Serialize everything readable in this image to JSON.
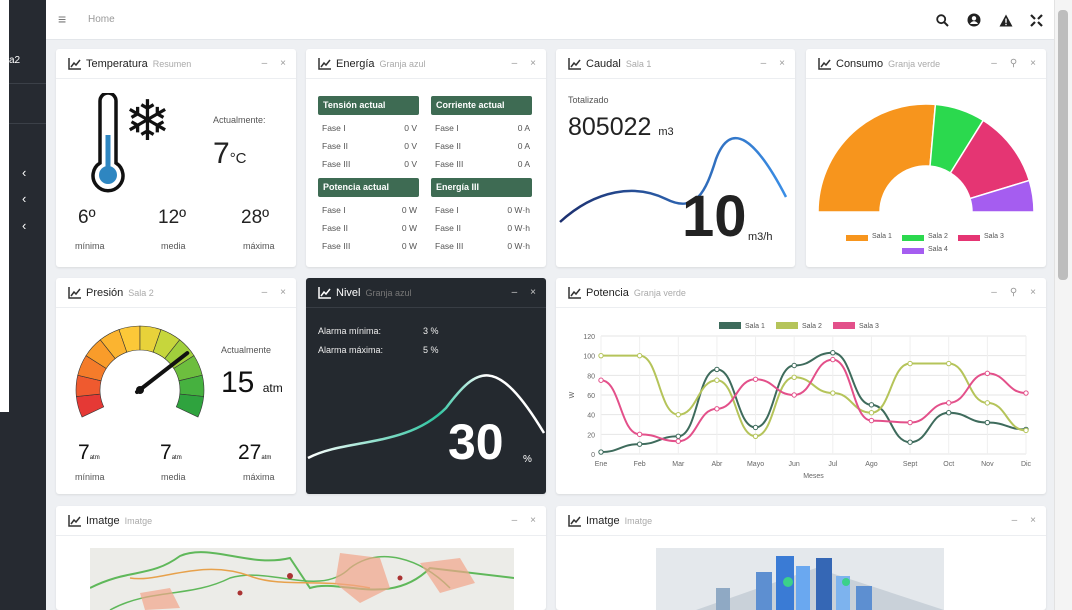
{
  "sidebar": {
    "brand": "a2"
  },
  "topbar": {
    "home": "Home"
  },
  "temperatura": {
    "title": "Temperatura",
    "sub": "Resumen",
    "current_label": "Actualmente:",
    "current": "7",
    "unit": "°C",
    "min": "6º",
    "avg": "12º",
    "max": "28º",
    "min_label": "mínima",
    "avg_label": "media",
    "max_label": "máxima"
  },
  "energia": {
    "title": "Energía",
    "sub": "Granja azul",
    "tension": {
      "header": "Tensión actual",
      "rows": [
        {
          "l": "Fase I",
          "v": "0 V"
        },
        {
          "l": "Fase II",
          "v": "0 V"
        },
        {
          "l": "Fase III",
          "v": "0 V"
        }
      ]
    },
    "corriente": {
      "header": "Corriente actual",
      "rows": [
        {
          "l": "Fase I",
          "v": "0 A"
        },
        {
          "l": "Fase II",
          "v": "0 A"
        },
        {
          "l": "Fase III",
          "v": "0 A"
        }
      ]
    },
    "potencia": {
      "header": "Potencia actual",
      "rows": [
        {
          "l": "Fase I",
          "v": "0 W"
        },
        {
          "l": "Fase II",
          "v": "0 W"
        },
        {
          "l": "Fase III",
          "v": "0 W"
        }
      ]
    },
    "energia3": {
      "header": "Energía III",
      "rows": [
        {
          "l": "Fase I",
          "v": "0 W·h"
        },
        {
          "l": "Fase II",
          "v": "0 W·h"
        },
        {
          "l": "Fase III",
          "v": "0 W·h"
        }
      ]
    }
  },
  "caudal": {
    "title": "Caudal",
    "sub": "Sala 1",
    "total_label": "Totalizado",
    "total": "805022",
    "total_unit": "m3",
    "value": "10",
    "unit": "m3/h"
  },
  "consumo": {
    "title": "Consumo",
    "sub": "Granja verde",
    "legend": [
      {
        "name": "Sala 1",
        "color": "#f7951d"
      },
      {
        "name": "Sala 2",
        "color": "#2bd94e"
      },
      {
        "name": "Sala 3",
        "color": "#e53573"
      },
      {
        "name": "Sala 4",
        "color": "#a55df0"
      }
    ]
  },
  "presion": {
    "title": "Presión",
    "sub": "Sala 2",
    "current_label": "Actualmente",
    "current": "15",
    "unit": "atm",
    "min": "7",
    "avg": "7",
    "max": "27",
    "small_unit": "atm",
    "min_label": "mínima",
    "avg_label": "media",
    "max_label": "máxima"
  },
  "nivel": {
    "title": "Nivel",
    "sub": "Granja azul",
    "alarm_min_label": "Alarma mínima:",
    "alarm_min": "3 %",
    "alarm_max_label": "Alarma máxima:",
    "alarm_max": "5 %",
    "value": "30",
    "unit": "%"
  },
  "potencia": {
    "title": "Potencia",
    "sub": "Granja verde"
  },
  "imatge1": {
    "title": "Imatge",
    "sub": "Imatge"
  },
  "imatge2": {
    "title": "Imatge",
    "sub": "Imatge"
  },
  "chart_data": {
    "type": "line",
    "categories": [
      "Ene",
      "Feb",
      "Mar",
      "Abr",
      "Mayo",
      "Jun",
      "Jul",
      "Ago",
      "Sept",
      "Oct",
      "Nov",
      "Dic"
    ],
    "xlabel": "Meses",
    "ylabel": "W",
    "ylim": [
      0,
      120
    ],
    "yticks": [
      0,
      20,
      40,
      60,
      80,
      100,
      120
    ],
    "series": [
      {
        "name": "Sala 1",
        "color": "#3e6b5c",
        "values": [
          2,
          10,
          18,
          86,
          27,
          90,
          103,
          50,
          12,
          42,
          32,
          25
        ]
      },
      {
        "name": "Sala 2",
        "color": "#b5c45a",
        "values": [
          100,
          100,
          40,
          75,
          18,
          78,
          62,
          42,
          92,
          92,
          52,
          24
        ]
      },
      {
        "name": "Sala 3",
        "color": "#e3508a",
        "values": [
          75,
          20,
          13,
          46,
          76,
          60,
          96,
          34,
          32,
          52,
          82,
          62
        ]
      }
    ],
    "legend": "top",
    "grid": true
  }
}
